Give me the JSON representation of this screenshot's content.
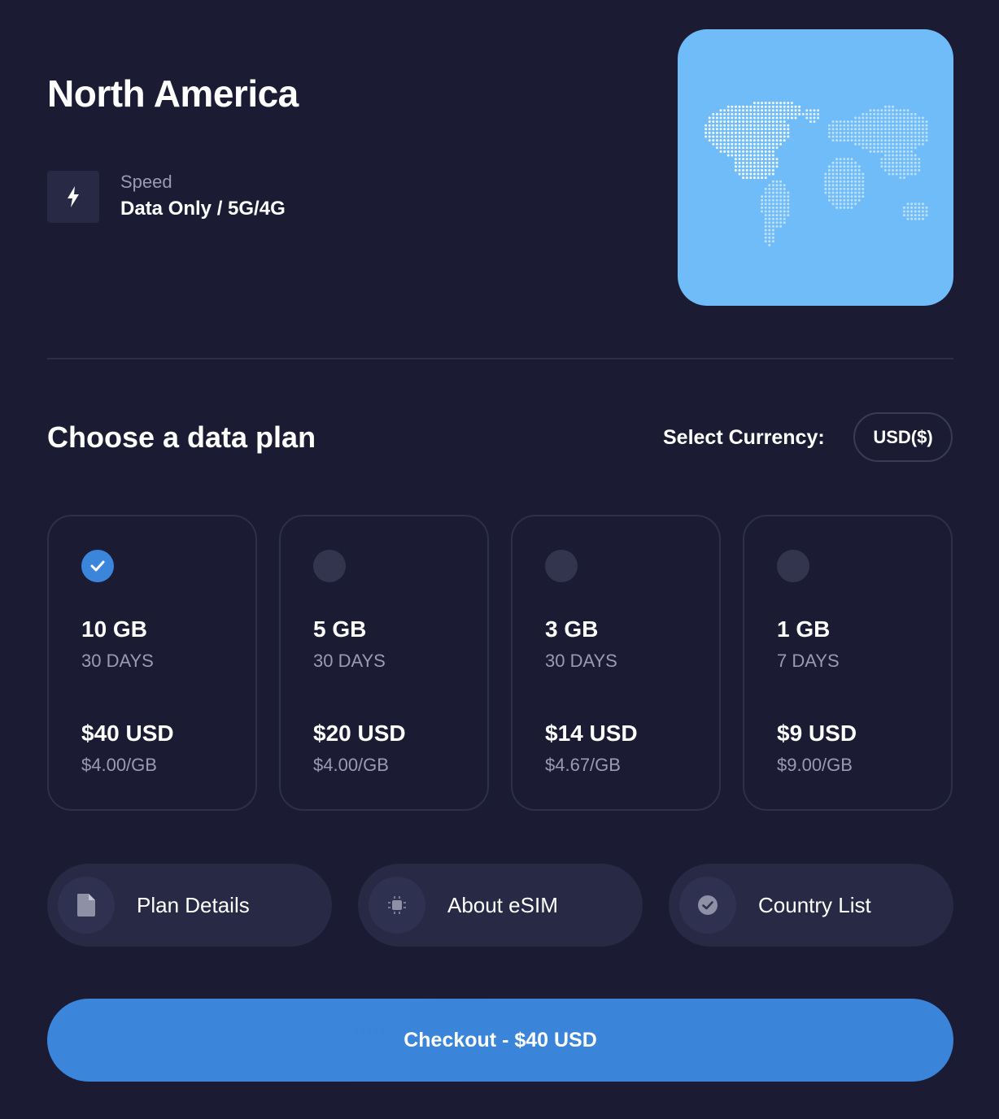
{
  "header": {
    "title": "North America",
    "speed_label": "Speed",
    "speed_value": "Data Only / 5G/4G",
    "speed_icon": "lightning-icon",
    "map_image": "world-map-dots"
  },
  "plans_section": {
    "title": "Choose a data plan",
    "currency_label": "Select Currency:",
    "currency_value": "USD($)"
  },
  "plans": [
    {
      "size": "10 GB",
      "days": "30 DAYS",
      "price": "$40 USD",
      "per_gb": "$4.00/GB",
      "selected": true
    },
    {
      "size": "5 GB",
      "days": "30 DAYS",
      "price": "$20 USD",
      "per_gb": "$4.00/GB",
      "selected": false
    },
    {
      "size": "3 GB",
      "days": "30 DAYS",
      "price": "$14 USD",
      "per_gb": "$4.67/GB",
      "selected": false
    },
    {
      "size": "1 GB",
      "days": "7 DAYS",
      "price": "$9 USD",
      "per_gb": "$9.00/GB",
      "selected": false
    }
  ],
  "info_buttons": [
    {
      "label": "Plan Details",
      "icon": "document-icon"
    },
    {
      "label": "About eSIM",
      "icon": "chip-icon"
    },
    {
      "label": "Country List",
      "icon": "check-circle-icon"
    }
  ],
  "checkout": {
    "label": "Checkout - $40 USD"
  },
  "colors": {
    "background": "#1b1c33",
    "card_border": "#2e3049",
    "pill_background": "#272945",
    "accent": "#3b86db",
    "map_background": "#6fbcf8",
    "muted_text": "#9a9bb2"
  }
}
